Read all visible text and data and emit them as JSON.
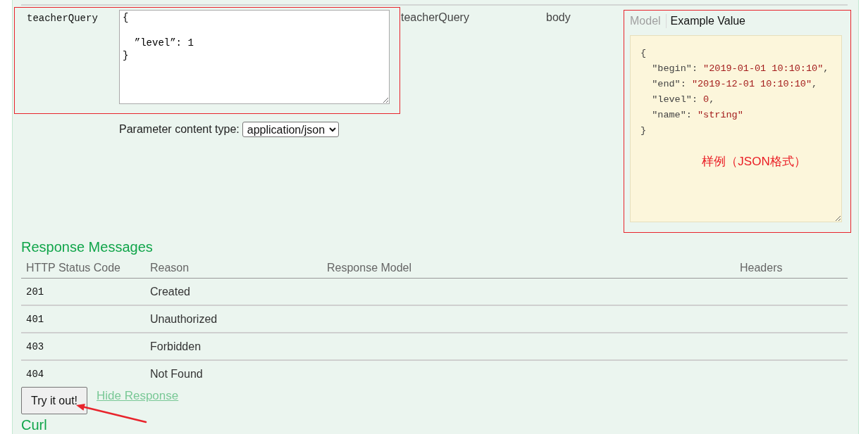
{
  "parameter": {
    "name": "teacherQuery",
    "value": "{\n\n  ”level”: 1\n}",
    "description": "teacherQuery",
    "parameter_type": "body",
    "content_type_label": "Parameter content type:",
    "content_type": "application/json",
    "model_tabs": [
      {
        "label": "Model",
        "selected": false
      },
      {
        "label": "Example Value",
        "selected": true
      }
    ],
    "example_value": {
      "open": "{",
      "fields": [
        [
          {
            "kind": "key",
            "text": "\"begin\""
          },
          {
            "kind": "punct",
            "text": ": "
          },
          {
            "kind": "string",
            "text": "\"2019-01-01 10:10:10\""
          },
          {
            "kind": "punct",
            "text": ","
          }
        ],
        [
          {
            "kind": "key",
            "text": "\"end\""
          },
          {
            "kind": "punct",
            "text": ": "
          },
          {
            "kind": "string",
            "text": "\"2019-12-01 10:10:10\""
          },
          {
            "kind": "punct",
            "text": ","
          }
        ],
        [
          {
            "kind": "key",
            "text": "\"level\""
          },
          {
            "kind": "punct",
            "text": ": "
          },
          {
            "kind": "number",
            "text": "0"
          },
          {
            "kind": "punct",
            "text": ","
          }
        ],
        [
          {
            "kind": "key",
            "text": "\"name\""
          },
          {
            "kind": "punct",
            "text": ": "
          },
          {
            "kind": "string",
            "text": "\"string\""
          }
        ]
      ],
      "close": "}"
    }
  },
  "annotation": {
    "note": "样例（JSON格式）"
  },
  "response_messages": {
    "title": "Response Messages",
    "columns": [
      "HTTP Status Code",
      "Reason",
      "Response Model",
      "Headers"
    ],
    "rows": [
      {
        "code": "201",
        "reason": "Created"
      },
      {
        "code": "401",
        "reason": "Unauthorized"
      },
      {
        "code": "403",
        "reason": "Forbidden"
      },
      {
        "code": "404",
        "reason": "Not Found"
      }
    ]
  },
  "actions": {
    "try_button": "Try it out!",
    "hide_link": "Hide Response"
  },
  "next_section": {
    "title": "Curl"
  }
}
